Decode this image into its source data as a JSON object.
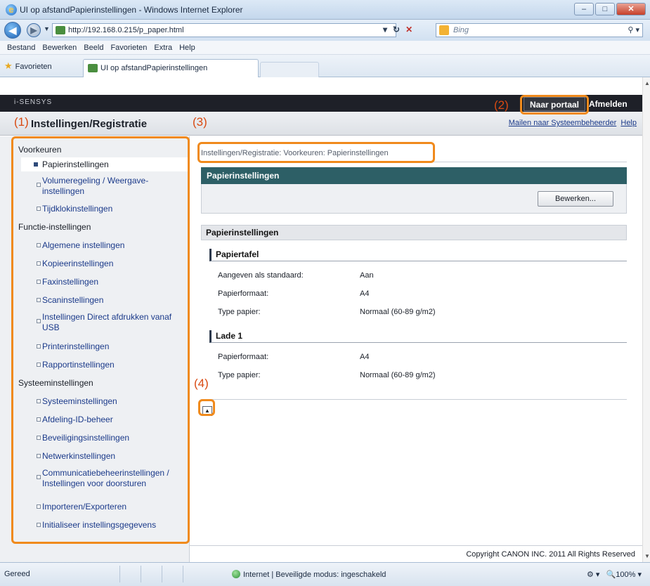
{
  "window": {
    "title": "UI op afstandPapierinstellingen - Windows Internet Explorer",
    "url": "http://192.168.0.215/p_paper.html",
    "search_placeholder": "Bing",
    "buttons": {
      "min": "–",
      "max": "□",
      "close": "✕"
    }
  },
  "menu": [
    "Bestand",
    "Bewerken",
    "Beeld",
    "Favorieten",
    "Extra",
    "Help"
  ],
  "favorites_label": "Favorieten",
  "tab_label": "UI op afstandPapierinstellingen",
  "header": {
    "model": "i-SENSYS",
    "portal_button": "Naar portaal",
    "logout": "Afmelden",
    "page_title": "Instellingen/Registratie",
    "mail_link": "Mailen naar Systeembeheerder",
    "help_link": "Help"
  },
  "sidebar": {
    "groups": [
      "Voorkeuren",
      "Functie-instellingen",
      "Systeeminstellingen"
    ],
    "items": [
      "Papierinstellingen",
      "Volumeregeling / Weergave-instellingen",
      "Tijdklokinstellingen",
      "Algemene instellingen",
      "Kopieerinstellingen",
      "Faxinstellingen",
      "Scaninstellingen",
      "Instellingen Direct afdrukken vanaf USB",
      "Printerinstellingen",
      "Rapportinstellingen",
      "Systeeminstellingen",
      "Afdeling-ID-beheer",
      "Beveiligingsinstellingen",
      "Netwerkinstellingen",
      "Communicatiebeheerinstellingen / Instellingen voor doorsturen",
      "Importeren/Exporteren",
      "Initialiseer instellingsgegevens"
    ]
  },
  "main": {
    "breadcrumb": "Instellingen/Registratie: Voorkeuren: Papierinstellingen",
    "box_title": "Papierinstellingen",
    "edit_button": "Bewerken...",
    "section_title": "Papierinstellingen",
    "papiertafel": {
      "title": "Papiertafel",
      "rows": [
        {
          "label": "Aangeven als standaard:",
          "value": "Aan"
        },
        {
          "label": "Papierformaat:",
          "value": "A4"
        },
        {
          "label": "Type papier:",
          "value": "Normaal (60-89 g/m2)"
        }
      ]
    },
    "lade1": {
      "title": "Lade 1",
      "rows": [
        {
          "label": "Papierformaat:",
          "value": "A4"
        },
        {
          "label": "Type papier:",
          "value": "Normaal (60-89 g/m2)"
        }
      ]
    }
  },
  "copyright": "Copyright CANON INC. 2011 All Rights Reserved",
  "callouts": [
    "(1)",
    "(2)",
    "(3)",
    "(4)"
  ],
  "status": {
    "left": "Gereed",
    "zone": "Internet | Beveiligde modus: ingeschakeld",
    "zoom": "100%"
  },
  "colors": {
    "highlight": "#f08a1c",
    "callout": "#d94a12",
    "panel_header": "#2d5f66"
  }
}
